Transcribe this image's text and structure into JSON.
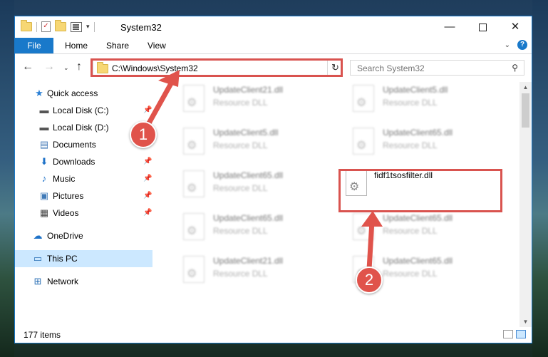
{
  "window": {
    "title": "System32",
    "controls": {
      "minimize": "—",
      "close": "✕"
    }
  },
  "ribbon": {
    "tabs": [
      "File",
      "Home",
      "Share",
      "View"
    ],
    "help": "?"
  },
  "address_bar": {
    "path": "C:\\Windows\\System32",
    "search_placeholder": "Search System32"
  },
  "sidebar": {
    "items": [
      {
        "label": "Quick access",
        "icon": "star-icon",
        "pinned": false
      },
      {
        "label": "Local Disk (C:)",
        "icon": "drive-icon",
        "pinned": true
      },
      {
        "label": "Local Disk (D:)",
        "icon": "drive-icon",
        "pinned": true
      },
      {
        "label": "Documents",
        "icon": "documents-icon",
        "pinned": true
      },
      {
        "label": "Downloads",
        "icon": "downloads-icon",
        "pinned": true
      },
      {
        "label": "Music",
        "icon": "music-icon",
        "pinned": true
      },
      {
        "label": "Pictures",
        "icon": "pictures-icon",
        "pinned": true
      },
      {
        "label": "Videos",
        "icon": "videos-icon",
        "pinned": true
      },
      {
        "label": "OneDrive",
        "icon": "cloud-icon",
        "pinned": false
      },
      {
        "label": "This PC",
        "icon": "computer-icon",
        "pinned": false,
        "selected": true
      },
      {
        "label": "Network",
        "icon": "network-icon",
        "pinned": false
      }
    ]
  },
  "files": [
    {
      "name": "UpdateClient21.dll",
      "type": "Resource DLL"
    },
    {
      "name": "UpdateClient5.dll",
      "type": "Resource DLL"
    },
    {
      "name": "UpdateClient5.dll",
      "type": "Resource DLL"
    },
    {
      "name": "UpdateClient65.dll",
      "type": "Resource DLL"
    },
    {
      "name": "UpdateClient65.dll",
      "type": "Resource DLL"
    },
    {
      "name": "fidf1tsosfilter.dll",
      "type": "",
      "highlighted": true
    },
    {
      "name": "UpdateClient65.dll",
      "type": "Resource DLL"
    },
    {
      "name": "UpdateClient65.dll",
      "type": "Resource DLL"
    },
    {
      "name": "UpdateClient21.dll",
      "type": "Resource DLL"
    },
    {
      "name": "UpdateClient65.dll",
      "type": "Resource DLL"
    }
  ],
  "status_bar": {
    "item_count": "177 items"
  },
  "annotations": {
    "marker_1": "1",
    "marker_2": "2",
    "color": "#e0534b"
  },
  "colors": {
    "accent": "#1979ca",
    "selection": "#cce8ff",
    "highlight": "#d9534f"
  }
}
